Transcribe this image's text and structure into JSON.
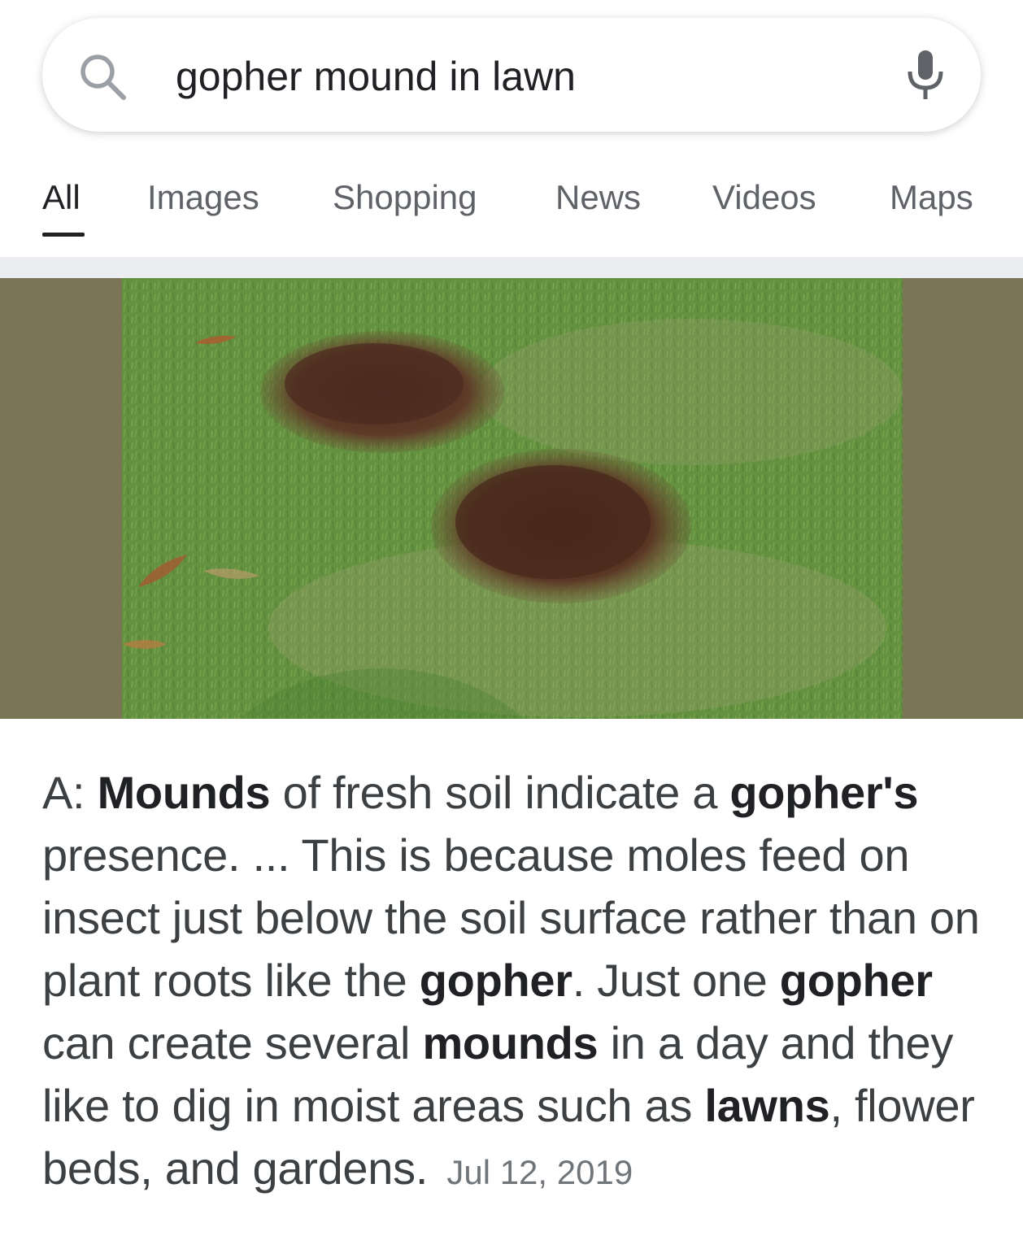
{
  "search": {
    "query": "gopher mound in lawn",
    "search_icon": "search-icon",
    "mic_icon": "microphone-icon"
  },
  "tabs": [
    {
      "label": "All",
      "active": true
    },
    {
      "label": "Images",
      "active": false
    },
    {
      "label": "Shopping",
      "active": false
    },
    {
      "label": "News",
      "active": false
    },
    {
      "label": "Videos",
      "active": false
    },
    {
      "label": "Maps",
      "active": false
    }
  ],
  "result": {
    "image_side_color": "#7b7558",
    "answer_segments": [
      {
        "text": "A: ",
        "bold": false
      },
      {
        "text": "Mounds",
        "bold": true
      },
      {
        "text": " of fresh soil indicate a ",
        "bold": false
      },
      {
        "text": "gopher's",
        "bold": true
      },
      {
        "text": " presence. ... This is because moles feed on insect just below the soil surface rather than on plant roots like the ",
        "bold": false
      },
      {
        "text": "gopher",
        "bold": true
      },
      {
        "text": ". Just one ",
        "bold": false
      },
      {
        "text": "gopher",
        "bold": true
      },
      {
        "text": " can create several ",
        "bold": false
      },
      {
        "text": "mounds",
        "bold": true
      },
      {
        "text": " in a day and they like to dig in moist areas such as ",
        "bold": false
      },
      {
        "text": "lawns",
        "bold": true
      },
      {
        "text": ", flower beds, and gardens.",
        "bold": false
      }
    ],
    "date": "Jul 12, 2019"
  }
}
